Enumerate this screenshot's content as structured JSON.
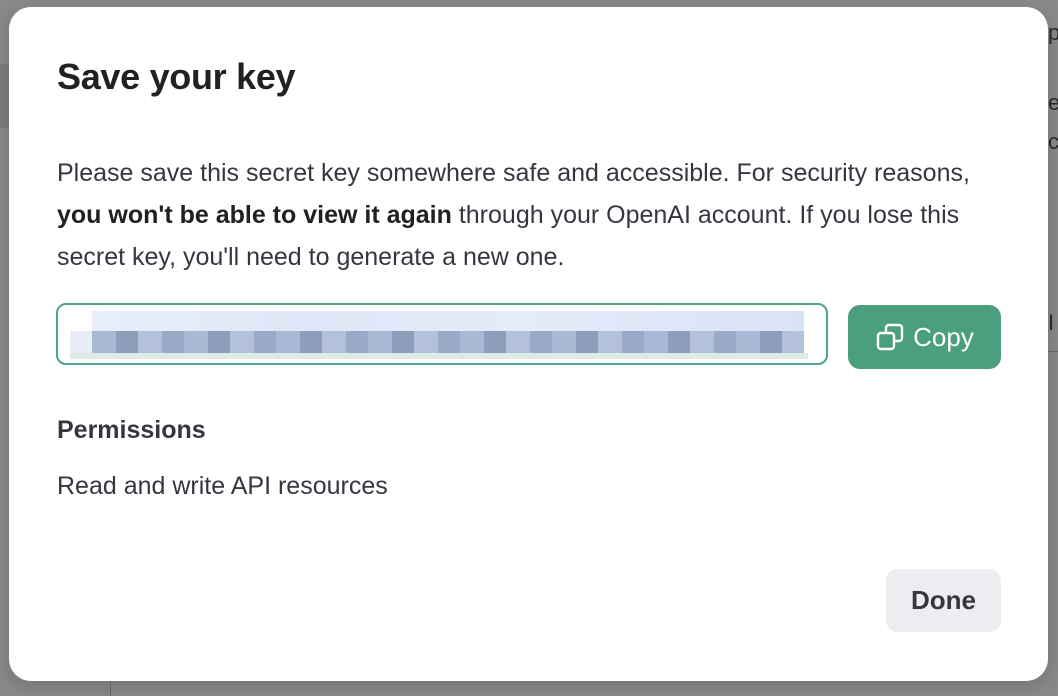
{
  "backdrop": {
    "peek_texts": [
      "p",
      "e",
      "c",
      "I"
    ]
  },
  "modal": {
    "title": "Save your key",
    "description": {
      "part1": "Please save this secret key somewhere safe and accessible. For security reasons, ",
      "bold": "you won't be able to view it again",
      "part2": " through your OpenAI account. If you lose this secret key, you'll need to generate a new one."
    },
    "key_field": {
      "value": ""
    },
    "copy_button": {
      "label": "Copy",
      "icon": "copy-icon",
      "color": "#4a9f7e"
    },
    "permissions": {
      "heading": "Permissions",
      "value": "Read and write API resources"
    },
    "done_button": {
      "label": "Done"
    },
    "colors": {
      "accent": "#4a9f7e",
      "field_border": "#4fa483",
      "text": "#353740"
    }
  }
}
